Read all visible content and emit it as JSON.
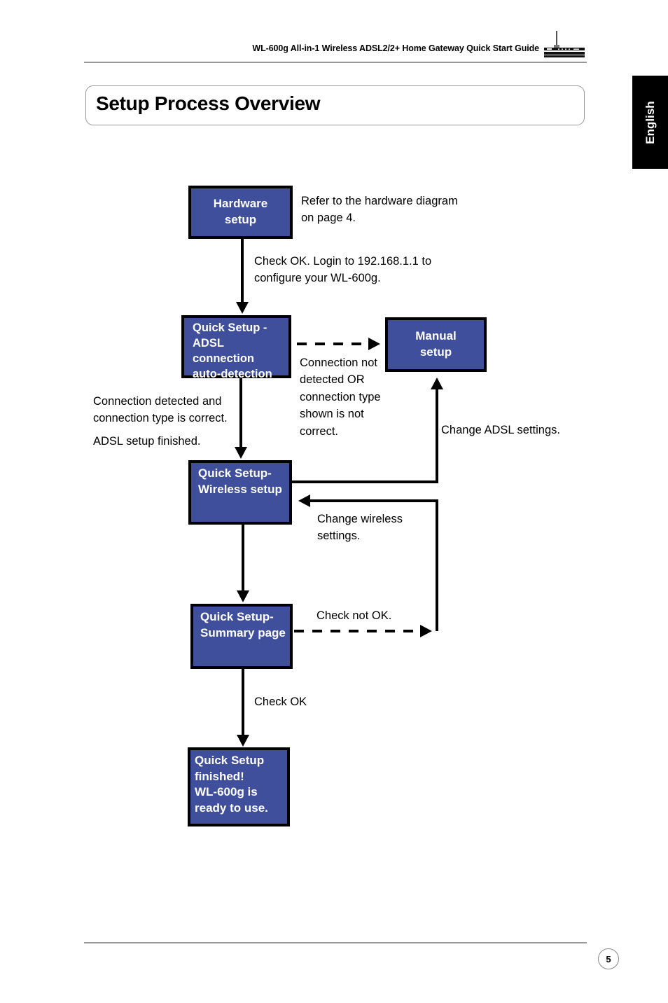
{
  "header": {
    "title": "WL-600g All-in-1 Wireless ADSL2/2+ Home Gateway Quick Start Guide",
    "router_icon": "router-icon"
  },
  "language_tab": {
    "label": "English"
  },
  "page_title": "Setup Process Overview",
  "flow": {
    "nodes": [
      {
        "id": "hardware",
        "label": "Hardware\nsetup"
      },
      {
        "id": "adsl",
        "label": "Quick Setup -\nADSL connection\nauto-detection"
      },
      {
        "id": "manual",
        "label": "Manual\nsetup"
      },
      {
        "id": "wireless",
        "label": "Quick Setup-\nWireless setup"
      },
      {
        "id": "summary",
        "label": "Quick Setup-\nSummary page"
      },
      {
        "id": "finished",
        "label": "Quick Setup\nfinished!\nWL-600g is\nready to use."
      }
    ],
    "annotations": [
      {
        "id": "hardware-note",
        "text": "Refer to the hardware diagram\non page 4."
      },
      {
        "id": "login-note",
        "text": "Check OK. Login to 192.168.1.1 to\nconfigure your WL-600g."
      },
      {
        "id": "not-detected-note",
        "text": "Connection not\ndetected OR\nconnection type\nshown is not\ncorrect."
      },
      {
        "id": "detected-note",
        "text": "Connection detected and\nconnection type is correct."
      },
      {
        "id": "adsl-finished-note",
        "text": "ADSL setup finished."
      },
      {
        "id": "change-adsl-note",
        "text": "Change ADSL settings."
      },
      {
        "id": "change-wireless-note",
        "text": "Change wireless\nsettings."
      },
      {
        "id": "check-not-ok-note",
        "text": "Check not OK."
      },
      {
        "id": "check-ok-note",
        "text": "Check OK"
      }
    ]
  },
  "footer": {
    "page_number": "5"
  },
  "colors": {
    "node_fill": "#3f4f9c",
    "node_border": "#000000",
    "node_text": "#ffffff",
    "rule": "#9a9a9a",
    "tab_background": "#000000"
  }
}
